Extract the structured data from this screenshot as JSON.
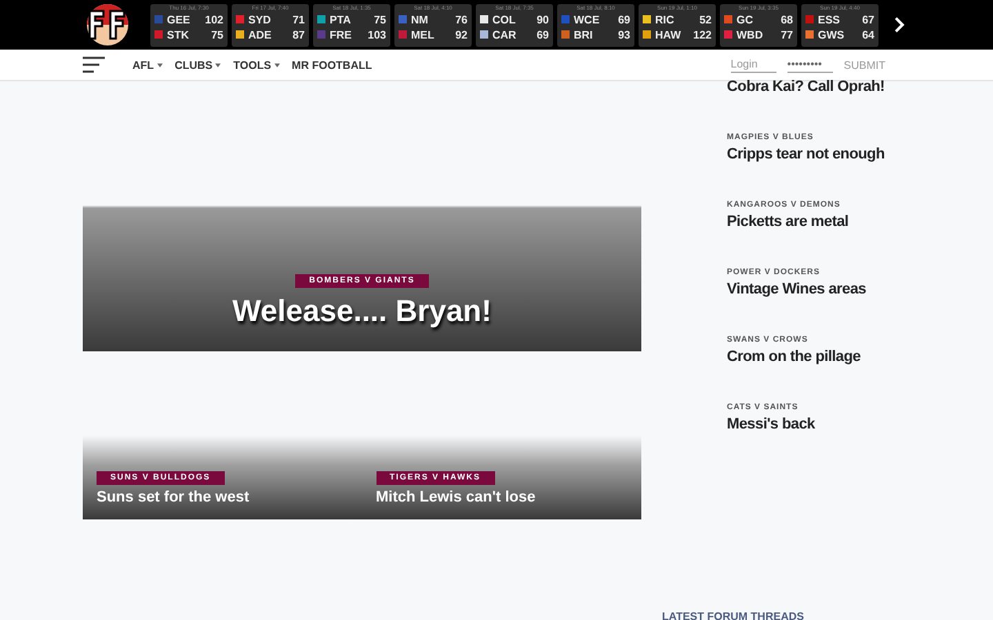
{
  "games": [
    {
      "time": "Thu 16 Jul, 7:30",
      "teams": [
        {
          "name": "GEE",
          "score": "102",
          "color": "#2a4a9a"
        },
        {
          "name": "STK",
          "score": "75",
          "color": "#d01a2a"
        }
      ]
    },
    {
      "time": "Fri 17 Jul, 7:40",
      "teams": [
        {
          "name": "SYD",
          "score": "71",
          "color": "#e0202a"
        },
        {
          "name": "ADE",
          "score": "87",
          "color": "#e8b020"
        }
      ]
    },
    {
      "time": "Sat 18 Jul, 1:35",
      "teams": [
        {
          "name": "PTA",
          "score": "75",
          "color": "#10a0a8"
        },
        {
          "name": "FRE",
          "score": "103",
          "color": "#5a3a8a"
        }
      ]
    },
    {
      "time": "Sat 18 Jul, 4:10",
      "teams": [
        {
          "name": "NM",
          "score": "76",
          "color": "#3a60c0"
        },
        {
          "name": "MEL",
          "score": "92",
          "color": "#c01a3a"
        }
      ]
    },
    {
      "time": "Sat 18 Jul, 7:35",
      "teams": [
        {
          "name": "COL",
          "score": "90",
          "color": "#e8e8e8"
        },
        {
          "name": "CAR",
          "score": "69",
          "color": "#a8b8d8"
        }
      ]
    },
    {
      "time": "Sat 18 Jul, 8:10",
      "teams": [
        {
          "name": "WCE",
          "score": "69",
          "color": "#2050c0"
        },
        {
          "name": "BRI",
          "score": "93",
          "color": "#d06020"
        }
      ]
    },
    {
      "time": "Sun 19 Jul, 1:10",
      "teams": [
        {
          "name": "RIC",
          "score": "52",
          "color": "#e8c020"
        },
        {
          "name": "HAW",
          "score": "122",
          "color": "#e0a010"
        }
      ]
    },
    {
      "time": "Sun 19 Jul, 3:35",
      "teams": [
        {
          "name": "GC",
          "score": "68",
          "color": "#e04a20"
        },
        {
          "name": "WBD",
          "score": "77",
          "color": "#e02040"
        }
      ]
    },
    {
      "time": "Sun 19 Jul, 4:40",
      "teams": [
        {
          "name": "ESS",
          "score": "67",
          "color": "#c01010"
        },
        {
          "name": "GWS",
          "score": "64",
          "color": "#e87030"
        }
      ]
    }
  ],
  "nav": [
    {
      "label": "AFL",
      "dropdown": true
    },
    {
      "label": "CLUBS",
      "dropdown": true
    },
    {
      "label": "TOOLS",
      "dropdown": true
    },
    {
      "label": "MR FOOTBALL",
      "dropdown": false
    }
  ],
  "login": {
    "placeholder": "Login",
    "password": "•••••••••",
    "submit": "SUBMIT"
  },
  "hero": {
    "tag": "BOMBERS V GIANTS",
    "title": "Welease.... Bryan!"
  },
  "cards": [
    {
      "tag": "SUNS V BULLDOGS",
      "title": "Suns set for the west"
    },
    {
      "tag": "TIGERS V HAWKS",
      "title": "Mitch Lewis can't lose"
    }
  ],
  "sidebar": [
    {
      "title": "Cobra Kai? Call Oprah!"
    },
    {
      "tag": "MAGPIES V BLUES",
      "title": "Cripps tear not enough"
    },
    {
      "tag": "KANGAROOS V DEMONS",
      "title": "Picketts are metal"
    },
    {
      "tag": "POWER V DOCKERS",
      "title": "Vintage Wines areas"
    },
    {
      "tag": "SWANS V CROWS",
      "title": "Crom on the pillage"
    },
    {
      "tag": "CATS V SAINTS",
      "title": "Messi's back"
    }
  ],
  "forum": {
    "heading": "LATEST FORUM THREADS"
  }
}
